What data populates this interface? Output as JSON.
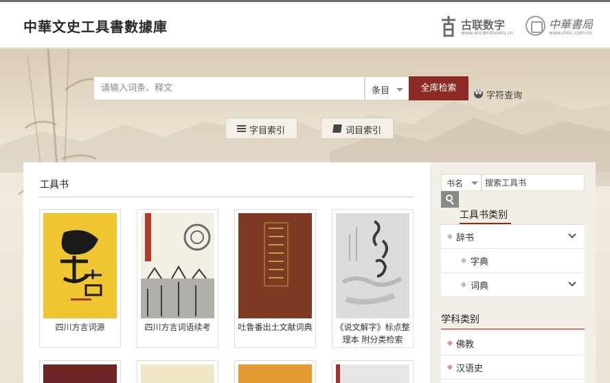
{
  "header": {
    "site_title": "中華文史工具書數據庫",
    "logo_ancient": {
      "name": "古联数字",
      "url": "www.ancientbooks.cn"
    },
    "logo_zhbc": {
      "name": "中華書局",
      "url": "www.zhbc.com.cn"
    }
  },
  "search": {
    "placeholder": "请输入词条、释文",
    "scope_value": "条目",
    "search_button": "全库检索",
    "char_query": "字符查询"
  },
  "index_buttons": {
    "char_index": "字目索引",
    "word_index": "词目索引"
  },
  "main": {
    "section_title": "工具书",
    "books": [
      {
        "title": "四川方言词源"
      },
      {
        "title": "四川方言词语续考"
      },
      {
        "title": "吐鲁番出土文献词典"
      },
      {
        "title": "《说文解字》标点整理本 附分类检索"
      }
    ]
  },
  "sidebar": {
    "filter_value": "书名",
    "search_placeholder": "搜索工具书",
    "category_heading": "工具书类别",
    "categories": [
      {
        "label": "辞书",
        "expandable": true
      },
      {
        "label": "字典",
        "expandable": false
      },
      {
        "label": "词典",
        "expandable": true
      }
    ],
    "subject_heading": "学科类别",
    "subjects": [
      {
        "label": "佛教"
      },
      {
        "label": "汉语史"
      }
    ]
  },
  "colors": {
    "accent": "#8e2a26",
    "background": "#ece4d4"
  }
}
